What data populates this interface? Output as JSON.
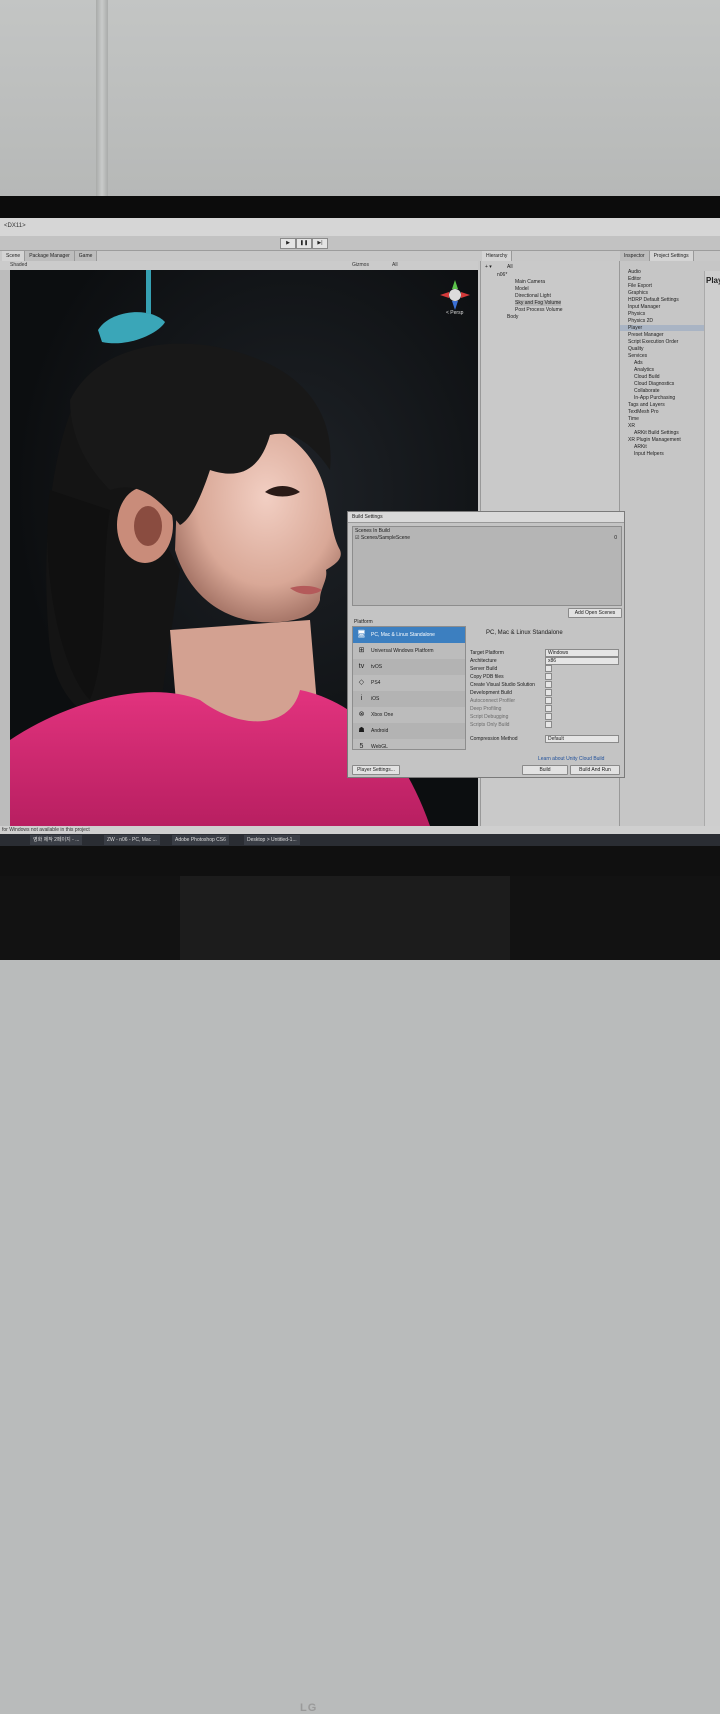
{
  "window": {
    "title": "<DX11>"
  },
  "toolbar": {
    "play": "▶",
    "pause": "❚❚",
    "step": "▶|"
  },
  "tabs": {
    "scene": "Scene",
    "package_manager": "Package Manager",
    "game": "Game",
    "hierarchy": "Hierarchy",
    "inspector": "Inspector",
    "project_settings": "Project Settings"
  },
  "scene_toolbar": {
    "shading": "Shaded",
    "gizmos": "Gizmos",
    "search": "All"
  },
  "scene_view": {
    "persp_label": "< Persp"
  },
  "hierarchy": {
    "search": "All",
    "items": [
      "n06*",
      "Main Camera",
      "Model",
      "Directional Light",
      "Sky and Fog Volume",
      "Post Process Volume",
      "Body"
    ]
  },
  "project_settings": {
    "items": [
      "Audio",
      "Editor",
      "File Export",
      "Graphics",
      "HDRP Default Settings",
      "Input Manager",
      "Physics",
      "Physics 2D",
      "Player",
      "Preset Manager",
      "Script Execution Order",
      "Quality",
      "Services",
      "Ads",
      "Analytics",
      "Cloud Build",
      "Cloud Diagnostics",
      "Collaborate",
      "In-App Purchasing",
      "Tags and Layers",
      "TextMesh Pro",
      "Time",
      "XR",
      "ARKit Build Settings",
      "XR Plugin Management",
      "ARKit",
      "Input Helpers"
    ],
    "inspector_title": "Play"
  },
  "build_settings": {
    "title": "Build Settings",
    "scenes_header": "Scenes In Build",
    "scene_entry": "Scenes/SampleScene",
    "scene_index": "0",
    "add_open_scenes": "Add Open Scenes",
    "platform_label": "Platform",
    "platforms": [
      "PC, Mac & Linux Standalone",
      "Universal Windows Platform",
      "tvOS",
      "PS4",
      "iOS",
      "Xbox One",
      "Android",
      "WebGL"
    ],
    "platform_icons": [
      "monitor-icon",
      "windows-icon",
      "tvos-icon",
      "ps4-icon",
      "ios-icon",
      "xbox-icon",
      "android-icon",
      "html5-icon"
    ],
    "selected_title": "PC, Mac & Linux Standalone",
    "options": {
      "target_platform": "Target Platform",
      "target_platform_value": "Windows",
      "architecture": "Architecture",
      "architecture_value": "x86",
      "server_build": "Server Build",
      "copy_pdb": "Copy PDB files",
      "vs_solution": "Create Visual Studio Solution",
      "development_build": "Development Build",
      "autoconnect_profiler": "Autoconnect Profiler",
      "deep_profiling": "Deep Profiling",
      "script_debugging": "Script Debugging",
      "scripts_only": "Scripts Only Build",
      "compression": "Compression Method",
      "compression_value": "Default"
    },
    "cloud_link": "Learn about Unity Cloud Build",
    "player_settings": "Player Settings...",
    "build": "Build",
    "build_and_run": "Build And Run"
  },
  "status_bar": {
    "message": "for Windows not available in this project"
  },
  "taskbar": {
    "items": [
      "영화 제작 2페이지 - ...",
      "ZW - n06 - PC, Mac ...",
      "Adobe Photoshop CS6",
      "Desktop > Untitled-1..."
    ]
  },
  "monitor": {
    "brand": "LG"
  }
}
